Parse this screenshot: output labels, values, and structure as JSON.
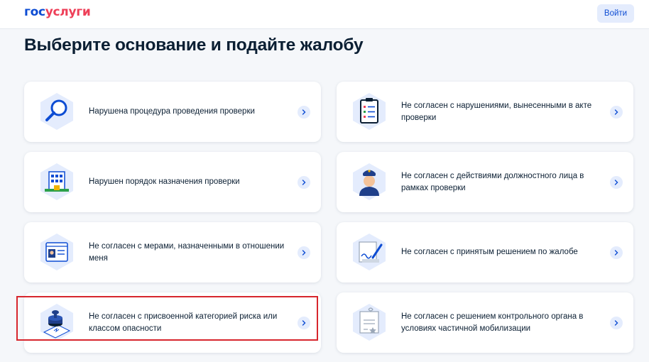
{
  "header": {
    "logo_part1": "гос",
    "logo_part2": "услуги",
    "login_label": "Войти"
  },
  "page_title": "Выберите основание и подайте жалобу",
  "colors": {
    "brand_blue": "#0d4cd3",
    "brand_red": "#ee3f58",
    "highlight": "#d7262d",
    "icon_bg": "#e4ecfd"
  },
  "options": [
    {
      "label": "Нарушена процедура проведения проверки",
      "icon": "magnifier-icon"
    },
    {
      "label": "Не согласен с нарушениями, вынесенными в акте проверки",
      "icon": "clipboard-checklist-icon"
    },
    {
      "label": "Нарушен порядок назначения проверки",
      "icon": "building-icon"
    },
    {
      "label": "Не согласен с действиями должностного лица в рамках проверки",
      "icon": "officer-icon"
    },
    {
      "label": "Не согласен с мерами, назначенными в отношении меня",
      "icon": "id-document-icon"
    },
    {
      "label": "Не согласен с принятым решением по жалобе",
      "icon": "signed-document-icon"
    },
    {
      "label": "Не согласен с присвоенной категорией риска или классом опасности",
      "icon": "stamp-icon",
      "highlighted": true
    },
    {
      "label": "Не согласен с решением контрольного органа в условиях частичной мобилизации",
      "icon": "certificate-icon"
    }
  ]
}
